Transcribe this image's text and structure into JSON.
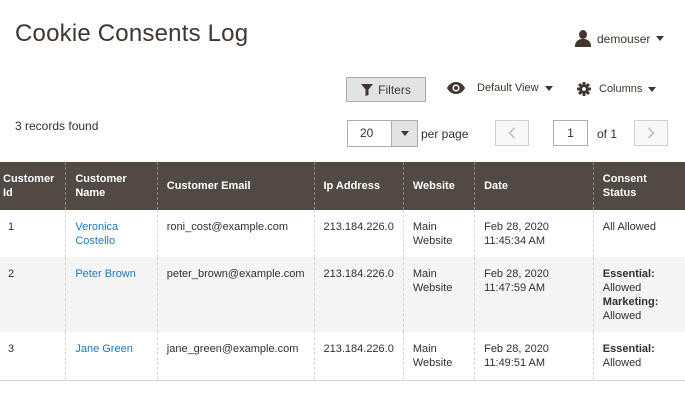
{
  "header": {
    "title": "Cookie Consents Log",
    "user": "demouser"
  },
  "toolbar": {
    "filters_label": "Filters",
    "view_label": "Default View",
    "columns_label": "Columns",
    "records_found": "3 records found",
    "per_page_value": "20",
    "per_page_label": "per page",
    "current_page": "1",
    "page_of": "of 1"
  },
  "grid": {
    "columns": [
      "Customer Id",
      "Customer Name",
      "Customer Email",
      "Ip Address",
      "Website",
      "Date",
      "Consent Status"
    ],
    "rows": [
      {
        "id": "1",
        "name": "Veronica Costello",
        "email": "roni_cost@example.com",
        "ip": "213.184.226.0",
        "website": "Main Website",
        "date": "Feb 28, 2020 11:45:34 AM",
        "status_text": "All Allowed"
      },
      {
        "id": "2",
        "name": "Peter Brown",
        "email": "peter_brown@example.com",
        "ip": "213.184.226.0",
        "website": "Main Website",
        "date": "Feb 28, 2020 11:47:59 AM",
        "status": [
          {
            "key": "Essential:",
            "value": "Allowed"
          },
          {
            "key": "Marketing:",
            "value": "Allowed"
          }
        ]
      },
      {
        "id": "3",
        "name": "Jane Green",
        "email": "jane_green@example.com",
        "ip": "213.184.226.0",
        "website": "Main Website",
        "date": "Feb 28, 2020 11:49:51 AM",
        "status": [
          {
            "key": "Essential:",
            "value": "Allowed"
          }
        ]
      }
    ]
  },
  "icons": {
    "user": "user-icon",
    "filter": "funnel-icon",
    "view": "eye-icon",
    "columns": "gear-icon",
    "prev": "chevron-left-icon",
    "next": "chevron-right-icon"
  },
  "colors": {
    "header_bg": "#514943",
    "link": "#1979c3",
    "title": "#41362f"
  }
}
